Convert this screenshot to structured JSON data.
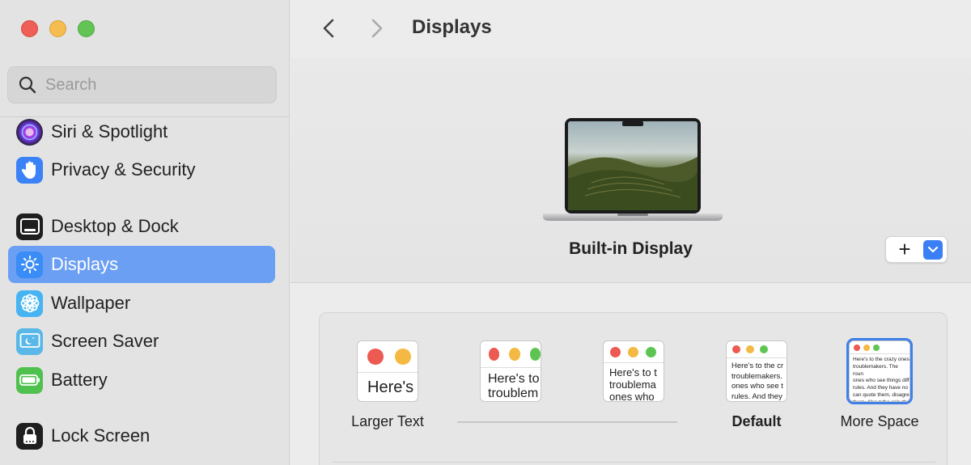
{
  "window": {
    "title": "Displays"
  },
  "search": {
    "placeholder": "Search"
  },
  "sidebar": {
    "items": [
      {
        "label": "Siri & Spotlight",
        "icon": "siri-icon"
      },
      {
        "label": "Privacy & Security",
        "icon": "hand-icon"
      },
      {
        "label": "Desktop & Dock",
        "icon": "desktop-dock-icon"
      },
      {
        "label": "Displays",
        "icon": "sun-icon",
        "selected": true
      },
      {
        "label": "Wallpaper",
        "icon": "flower-icon"
      },
      {
        "label": "Screen Saver",
        "icon": "screen-saver-icon"
      },
      {
        "label": "Battery",
        "icon": "battery-icon"
      },
      {
        "label": "Lock Screen",
        "icon": "lock-icon"
      }
    ]
  },
  "display": {
    "name": "Built-in Display",
    "add_label": "+"
  },
  "resolution": {
    "options": [
      {
        "label": "Larger Text",
        "thumb_text": "Here's",
        "bold": false,
        "selected": false
      },
      {
        "label": "",
        "thumb_text": "Here's to\ntroublem",
        "bold": false,
        "selected": false
      },
      {
        "label": "",
        "thumb_text": "Here's to t\ntroublema\nones who",
        "bold": false,
        "selected": false
      },
      {
        "label": "Default",
        "thumb_text": "Here's to the cr\ntroublemakers.\nones who see t\nrules. And they",
        "bold": true,
        "selected": false
      },
      {
        "label": "More Space",
        "thumb_text": "Here's to the crazy ones\ntroublemakers. The roun\nones who see things diff\nrules. And they have no\ncan quote them, disagre\nthem. About the only th\nBecause they change t",
        "bold": false,
        "selected": true
      }
    ]
  },
  "colors": {
    "accent": "#3a7ff5",
    "selection": "#6a9ff4"
  }
}
